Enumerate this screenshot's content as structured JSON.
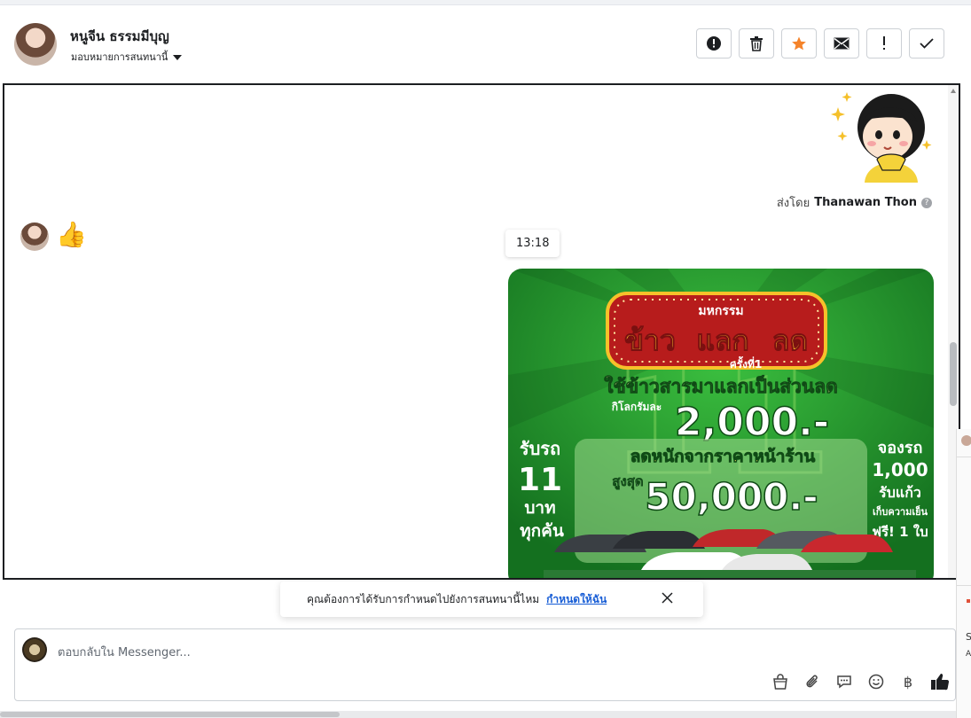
{
  "contact": {
    "name": "หนูจีน ธรรมมีบุญ",
    "assign_label": "มอบหมายการสนทนานี้"
  },
  "toolbar": [
    {
      "name": "alert-button",
      "icon": "alert-circle-icon"
    },
    {
      "name": "delete-button",
      "icon": "trash-icon"
    },
    {
      "name": "star-button",
      "icon": "star-icon"
    },
    {
      "name": "mark-unread-button",
      "icon": "envelope-icon"
    },
    {
      "name": "spam-button",
      "icon": "exclamation-icon"
    },
    {
      "name": "done-button",
      "icon": "check-icon"
    }
  ],
  "messages": {
    "sent_by_prefix": "ส่งโดย",
    "sent_by_name": "Thanawan Thon",
    "received_emoji": "👍",
    "timestamp": "13:18"
  },
  "promo": {
    "tag": "มหกรรม",
    "headline_1": "ข้าว",
    "headline_2": "แลก",
    "headline_3": "ลด",
    "subtag": "ครั้งที่1",
    "line_1": "ใช้ข้าวสารมาแลกเป็นส่วนลด",
    "per_kg": "กิโลกรัมละ",
    "amount_1": "2,000.-",
    "left_1": "รับรถ",
    "left_2": "11",
    "left_3": "บาท",
    "left_4": "ทุกคัน",
    "box_line": "ลดหนักจากราคาหน้าร้าน",
    "max_label": "สูงสุด",
    "amount_2": "50,000.-",
    "right_1": "จองรถ",
    "right_2": "1,000",
    "right_3": "รับแก้ว",
    "right_4": "เก็บความเย็น",
    "right_5": "ฟรี! 1 ใบ",
    "bg_number": "11"
  },
  "toast": {
    "text": "คุณต้องการได้รับการกำหนดไปยังการสนทนานี้ไหม",
    "link": "กำหนดให้ฉัน"
  },
  "composer": {
    "placeholder": "ตอบกลับใน Messenger...",
    "tools": [
      {
        "name": "shop-button",
        "icon": "shopping-bag-icon"
      },
      {
        "name": "attach-button",
        "icon": "paperclip-icon"
      },
      {
        "name": "saved-reply-button",
        "icon": "chat-bubble-icon"
      },
      {
        "name": "emoji-button",
        "icon": "smiley-icon"
      },
      {
        "name": "payment-button",
        "icon": "baht-icon",
        "glyph": "฿"
      },
      {
        "name": "like-button",
        "icon": "thumbs-up-icon"
      }
    ]
  },
  "right_panel": {
    "letter_1": "S",
    "letter_2": "A"
  },
  "colors": {
    "accent": "#f5832a",
    "link": "#1a5fd6",
    "promo_green": "#1f8a2c",
    "promo_gold": "#f7c12a"
  }
}
